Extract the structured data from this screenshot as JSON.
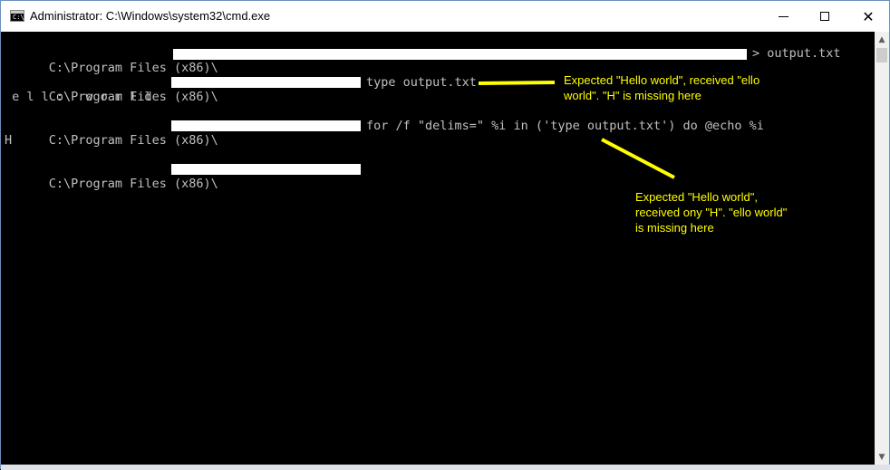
{
  "window": {
    "title": "Administrator: C:\\Windows\\system32\\cmd.exe",
    "icon": "cmd-icon",
    "icon_text": "C:\\",
    "minimize_icon": "minimize-icon",
    "maximize_icon": "maximize-icon",
    "close_glyph": "✕"
  },
  "console": {
    "lines": [
      {
        "prompt": "C:\\Program Files (x86)\\",
        "command": "> output.txt"
      },
      {
        "prompt": "C:\\Program Files (x86)\\",
        "command": "type output.txt"
      },
      {
        "output": " e l l o   w o r l d"
      },
      {
        "prompt": "C:\\Program Files (x86)\\",
        "command": "for /f \"delims=\" %i in ('type output.txt') do @echo %i"
      },
      {
        "output": "H"
      },
      {
        "prompt": "C:\\Program Files (x86)\\",
        "command": ""
      }
    ]
  },
  "annotations": [
    {
      "text": "Expected \"Hello world\", received \"ello\nworld\". \"H\" is missing here"
    },
    {
      "text": "Expected \"Hello world\",\nreceived ony \"H\". \"ello world\"\nis missing here"
    }
  ],
  "colors": {
    "console_bg": "#000000",
    "console_text": "#c0c0c0",
    "annotation": "#ffff00",
    "redaction": "#ffffff"
  },
  "scrollbar": {
    "up_glyph": "▲",
    "down_glyph": "▼"
  }
}
